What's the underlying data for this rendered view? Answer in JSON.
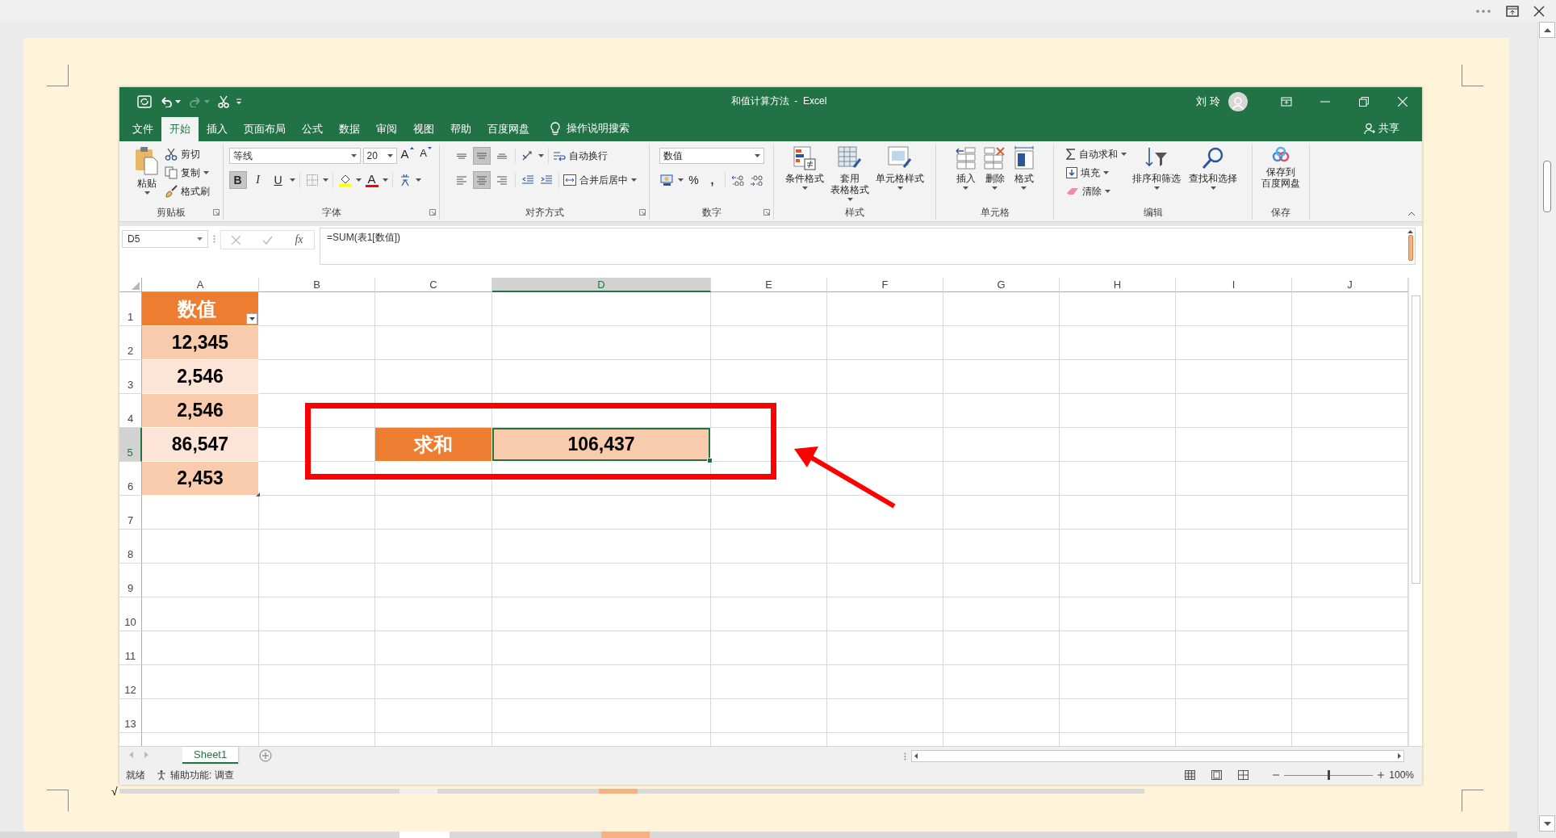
{
  "viewer": {
    "page_mark": "√"
  },
  "excel": {
    "quick_access": [
      {
        "kind": "save",
        "disabled": false
      },
      {
        "kind": "undo",
        "disabled": false
      },
      {
        "kind": "redo",
        "disabled": true
      },
      {
        "kind": "cut",
        "disabled": false
      }
    ],
    "title": "和值计算方法  -  Excel",
    "user": "刘 玲",
    "tabs": [
      {
        "label": "文件",
        "selected": false
      },
      {
        "label": "开始",
        "selected": true
      },
      {
        "label": "插入",
        "selected": false
      },
      {
        "label": "页面布局",
        "selected": false
      },
      {
        "label": "公式",
        "selected": false
      },
      {
        "label": "数据",
        "selected": false
      },
      {
        "label": "审阅",
        "selected": false
      },
      {
        "label": "视图",
        "selected": false
      },
      {
        "label": "帮助",
        "selected": false
      },
      {
        "label": "百度网盘",
        "selected": false
      }
    ],
    "tell_me": "操作说明搜索",
    "share": "共享",
    "ribbon": {
      "groups": [
        {
          "kind": "clipboard",
          "title": "剪贴板",
          "paste": "粘贴",
          "commands": [
            "剪切",
            "复制",
            "格式刷"
          ]
        },
        {
          "kind": "font",
          "title": "字体",
          "font": "等线",
          "size": "20",
          "grow": "A",
          "shrink": "A",
          "bold": {
            "label": "B",
            "selected": true
          },
          "italic": {
            "label": "I",
            "selected": false
          },
          "underline": {
            "label": "U",
            "selected": false
          },
          "color_label": "A"
        },
        {
          "kind": "alignment",
          "title": "对齐方式",
          "vertical": [
            {
              "selected": false
            },
            {
              "selected": true
            },
            {
              "selected": false
            }
          ],
          "horizontal": [
            {
              "selected": false
            },
            {
              "selected": true
            },
            {
              "selected": false
            }
          ],
          "wrap": "自动换行",
          "merge": "合并后居中"
        },
        {
          "kind": "number",
          "title": "数字",
          "format": "数值",
          "percent": "%",
          "comma": ","
        },
        {
          "kind": "styles",
          "title": "样式",
          "commands": [
            [
              "条件格式"
            ],
            [
              "套用",
              "表格格式"
            ],
            [
              "单元格样式"
            ]
          ]
        },
        {
          "kind": "cells",
          "title": "单元格",
          "commands": [
            "插入",
            "删除",
            "格式"
          ]
        },
        {
          "kind": "editing",
          "title": "编辑",
          "small": [
            "自动求和",
            "填充",
            "清除"
          ],
          "large": [
            "排序和筛选",
            "查找和选择"
          ]
        },
        {
          "kind": "save",
          "title": "保存",
          "command": [
            "保存到",
            "百度网盘"
          ]
        }
      ]
    },
    "name_box": "D5",
    "fx": "fx",
    "formula": "=SUM(表1[数值])",
    "columns": [
      {
        "label": "A",
        "selected": false
      },
      {
        "label": "B",
        "selected": false
      },
      {
        "label": "C",
        "selected": false
      },
      {
        "label": "D",
        "selected": true
      },
      {
        "label": "E",
        "selected": false
      },
      {
        "label": "F",
        "selected": false
      },
      {
        "label": "G",
        "selected": false
      },
      {
        "label": "H",
        "selected": false
      },
      {
        "label": "I",
        "selected": false
      },
      {
        "label": "J",
        "selected": false
      }
    ],
    "rows": [
      {
        "label": "1",
        "selected": false
      },
      {
        "label": "2",
        "selected": false
      },
      {
        "label": "3",
        "selected": false
      },
      {
        "label": "4",
        "selected": false
      },
      {
        "label": "5",
        "selected": true
      },
      {
        "label": "6",
        "selected": false
      },
      {
        "label": "7",
        "selected": false
      },
      {
        "label": "8",
        "selected": false
      },
      {
        "label": "9",
        "selected": false
      },
      {
        "label": "10",
        "selected": false
      },
      {
        "label": "11",
        "selected": false
      },
      {
        "label": "12",
        "selected": false
      },
      {
        "label": "13",
        "selected": false
      }
    ],
    "table": {
      "header": "数值",
      "values": [
        "12,345",
        "2,546",
        "2,546",
        "86,547",
        "2,453"
      ]
    },
    "sum": {
      "label": "求和",
      "value": "106,437",
      "selected": true
    },
    "sheets": [
      {
        "label": "Sheet1",
        "selected": true
      }
    ],
    "status": "就绪",
    "accessibility": "辅助功能: 调查",
    "zoom_slider": {
      "level": 0.5
    },
    "zoom": "100%"
  }
}
